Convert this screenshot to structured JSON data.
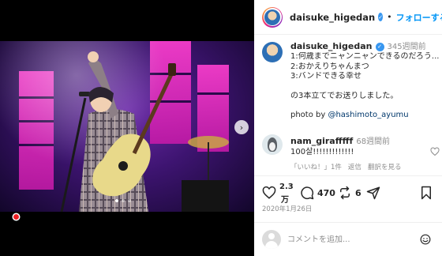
{
  "header": {
    "username": "daisuke_higedan",
    "separator": "•",
    "follow_label": "フォローする",
    "more_label": "···"
  },
  "caption": {
    "username": "daisuke_higedan",
    "time": "345週間前",
    "lines": [
      "1:何歳までニャンニャンできるのだろう...",
      "2:おかえりちゃんまつ",
      "3:バンドできる幸せ",
      "",
      "の3本立てでお送りしました。",
      "",
      "photo by "
    ],
    "mention": "@hashimoto_ayumu"
  },
  "comment": {
    "username": "nam_girafffff",
    "time": "68週間前",
    "text": "100살!!!!!!!!!!!!!",
    "likes": "「いいね！」1件",
    "reply": "返信",
    "translate": "翻訳を見る"
  },
  "actions": {
    "like_count_top": "2.3",
    "like_count_bottom": "万",
    "comment_count": "470",
    "repost_count": "6"
  },
  "date": "2020年1月26日",
  "comment_input": {
    "placeholder": "コメントを追加..."
  },
  "carousel": {
    "next_label": "›",
    "dot_count": 3,
    "active_dot": 0
  },
  "colors": {
    "accent": "#0095f6",
    "verified": "#3897f0",
    "record": "#ed2024",
    "stage_pink": "#ff3fd0",
    "stage_purple": "#3d1470"
  },
  "icons": {
    "like": "heart-icon",
    "comment": "comment-icon",
    "repost": "repost-icon",
    "share": "send-icon",
    "save": "bookmark-icon",
    "emoji": "emoji-icon",
    "more": "more-icon"
  }
}
